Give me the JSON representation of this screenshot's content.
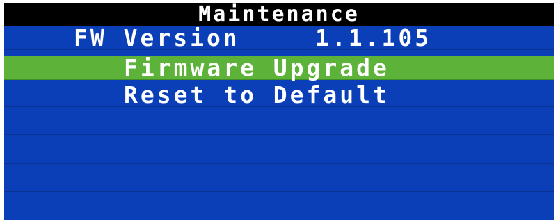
{
  "title": "Maintenance",
  "fw_version": {
    "label": "FW Version",
    "value": "1.1.105"
  },
  "menu": [
    {
      "label": "Firmware Upgrade",
      "selected": true
    },
    {
      "label": "Reset to Default",
      "selected": false
    }
  ],
  "colors": {
    "background": "#0a3fb8",
    "title_bar": "#000000",
    "highlight": "#5db23a",
    "text": "#ffffff"
  }
}
